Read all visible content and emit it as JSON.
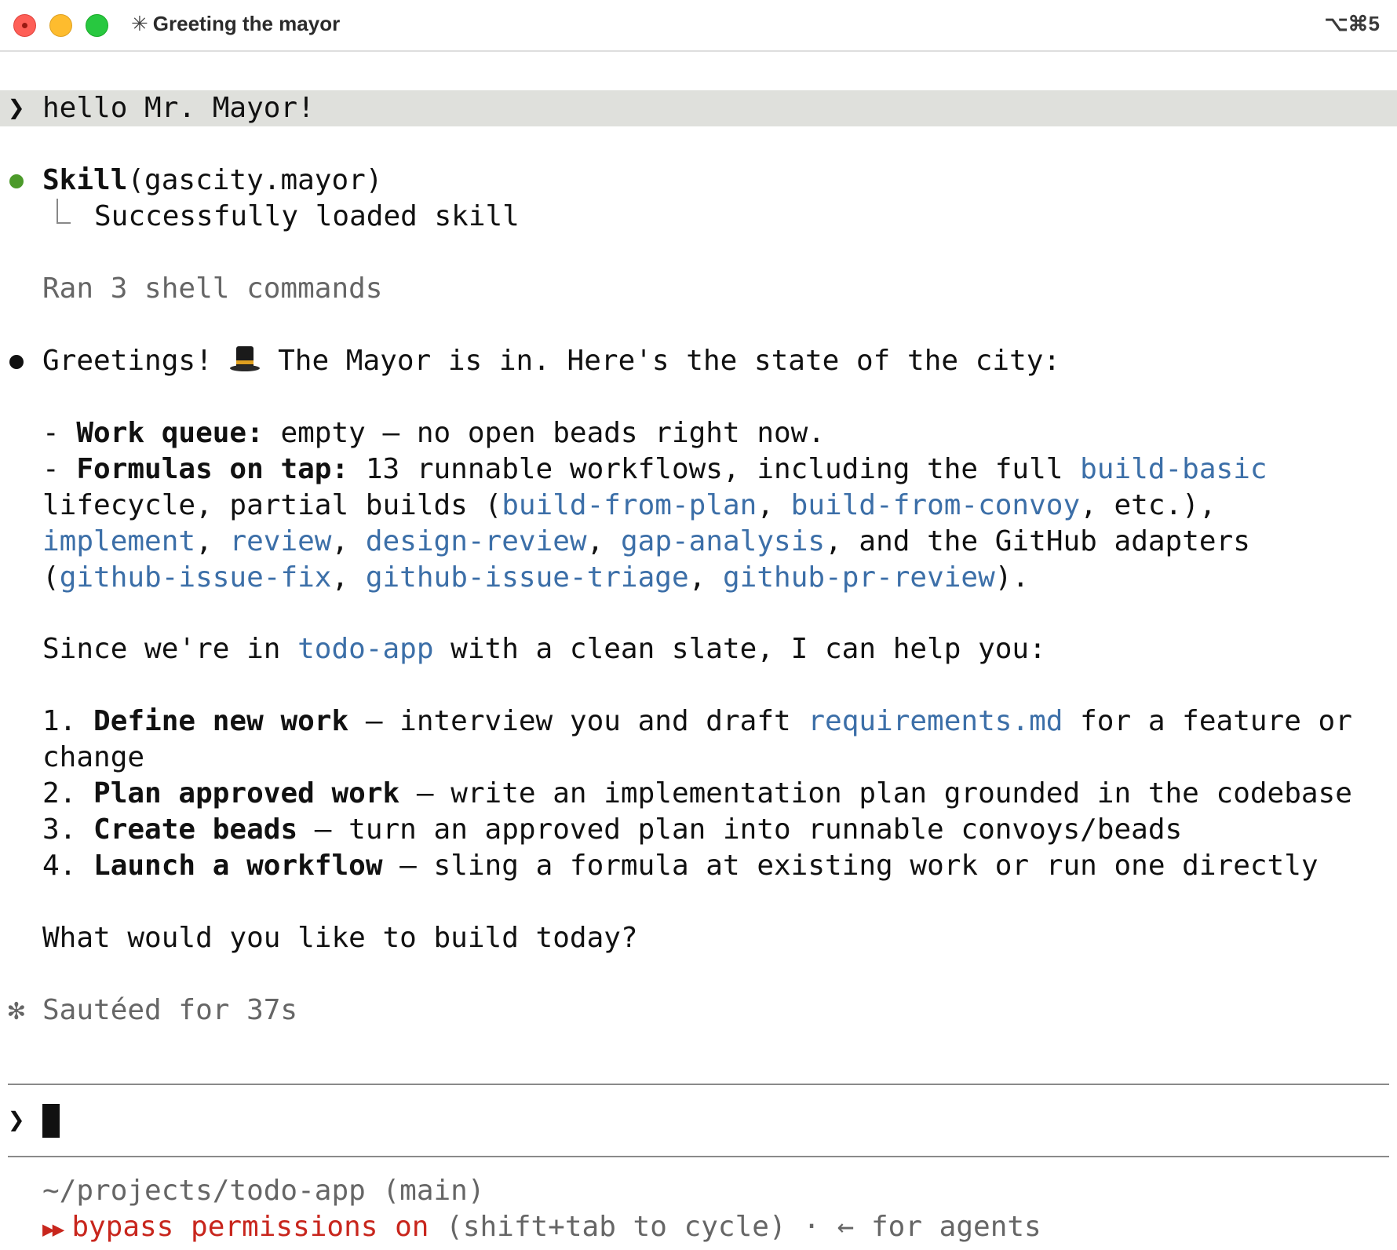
{
  "window": {
    "title": "Greeting the mayor",
    "title_spinner": "✳",
    "shortcut": "⌥⌘5"
  },
  "user_message": {
    "prompt_glyph": "❯",
    "text": "hello Mr. Mayor!"
  },
  "tool_call": {
    "name": "Skill",
    "args": "(gascity.mayor)",
    "result": "Successfully loaded skill"
  },
  "shell_summary": "Ran 3 shell commands",
  "response": {
    "greeting_before_emoji": "Greetings! ",
    "emoji": "tophat-icon",
    "greeting_after_emoji": " The Mayor is in. Here's the state of the city:",
    "bullets": [
      {
        "dash": "- ",
        "label": "Work queue:",
        "text": " empty — no open beads right now."
      },
      {
        "dash": "- ",
        "label": "Formulas on tap:",
        "text": " 13 runnable workflows, including the full ",
        "link": "build-basic"
      }
    ],
    "formulas_line2": {
      "pre": "lifecycle, partial builds (",
      "link1": "build-from-plan",
      "sep1": ", ",
      "link2": "build-from-convoy",
      "post": ", etc.),"
    },
    "formulas_line3": {
      "link1": "implement",
      "sep1": ", ",
      "link2": "review",
      "sep2": ", ",
      "link3": "design-review",
      "sep3": ", ",
      "link4": "gap-analysis",
      "post": ", and the GitHub adapters"
    },
    "formulas_line4": {
      "pre": "(",
      "link1": "github-issue-fix",
      "sep1": ", ",
      "link2": "github-issue-triage",
      "sep2": ", ",
      "link3": "github-pr-review",
      "post": ")."
    },
    "context_line": {
      "pre": "Since we're in ",
      "link": "todo-app",
      "post": " with a clean slate, I can help you:"
    },
    "options": [
      {
        "num": "1. ",
        "label": "Define new work",
        "text": " — interview you and draft ",
        "link": "requirements.md",
        "post": " for a feature or",
        "wrap": "change"
      },
      {
        "num": "2. ",
        "label": "Plan approved work",
        "text": " — write an implementation plan grounded in the codebase"
      },
      {
        "num": "3. ",
        "label": "Create beads",
        "text": " — turn an approved plan into runnable convoys/beads"
      },
      {
        "num": "4. ",
        "label": "Launch a workflow",
        "text": " — sling a formula at existing work or run one directly"
      }
    ],
    "question": "What would you like to build today?"
  },
  "status": {
    "glyph": "✻",
    "text": "Sautéed for 37s"
  },
  "input": {
    "prompt_glyph": "❯",
    "value": ""
  },
  "footer": {
    "cwd": "~/projects/todo-app (main)",
    "mode_glyph": "▶▶",
    "mode_label": "bypass permissions on",
    "mode_hint": " (shift+tab to cycle) · ← for agents"
  },
  "colors": {
    "link": "#3c6fa8",
    "danger": "#c8261d",
    "success_dot": "#4c9a2a",
    "user_row_bg": "#dfe0dc"
  }
}
